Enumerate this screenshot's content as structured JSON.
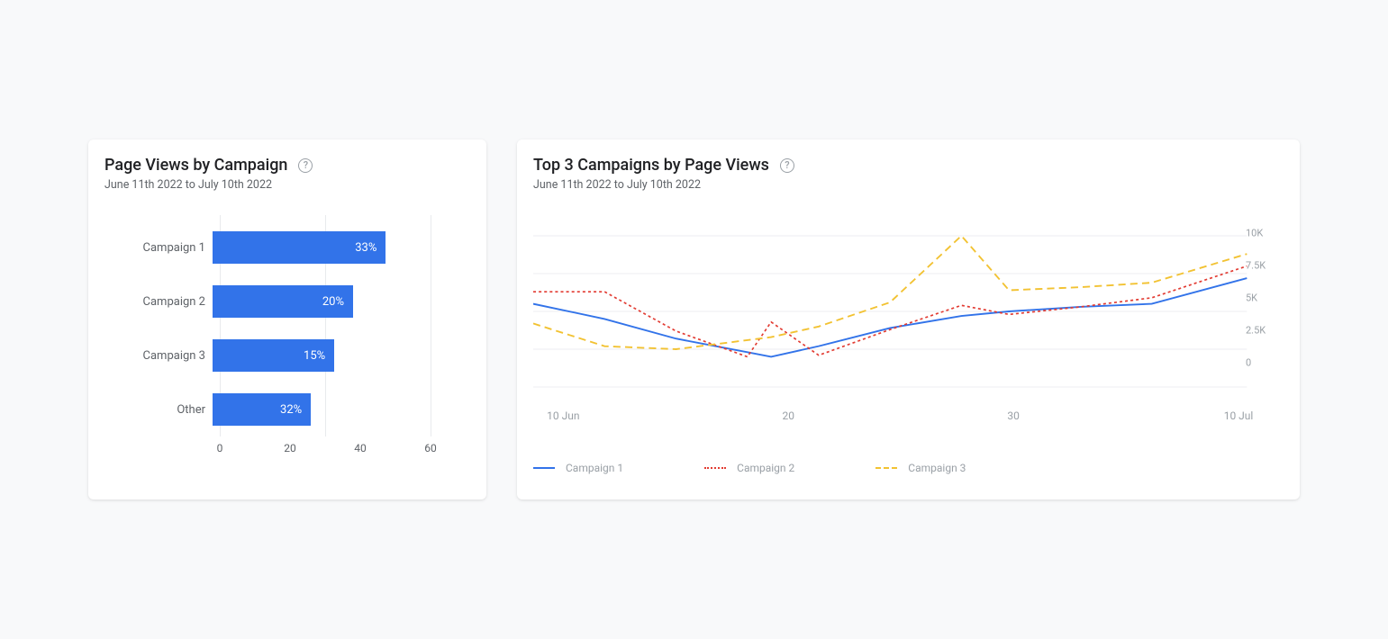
{
  "left_card": {
    "title": "Page Views by Campaign",
    "subtitle": "June 11th 2022 to July 10th 2022"
  },
  "right_card": {
    "title": "Top 3 Campaigns by Page Views",
    "subtitle": "June 11th 2022 to July 10th 2022"
  },
  "bar_labels": {
    "r0": "Campaign 1",
    "r1": "Campaign 2",
    "r2": "Campaign 3",
    "r3": "Other",
    "v0": "33%",
    "v1": "20%",
    "v2": "15%",
    "v3": "32%",
    "x0": "0",
    "x1": "20",
    "x2": "40",
    "x3": "60"
  },
  "line_axis": {
    "y0": "10K",
    "y1": "7.5K",
    "y2": "5K",
    "y3": "2.5K",
    "y4": "0",
    "x0": "10 Jun",
    "x1": "20",
    "x2": "30",
    "x3": "10 Jul"
  },
  "legend": {
    "s1": "Campaign 1",
    "s2": "Campaign 2",
    "s3": "Campaign 3"
  },
  "chart_data": [
    {
      "type": "bar",
      "orientation": "horizontal",
      "title": "Page Views by Campaign",
      "subtitle": "June 11th 2022 to July 10th 2022",
      "xlabel": "",
      "ylabel": "",
      "xlim": [
        0,
        60
      ],
      "categories": [
        "Campaign 1",
        "Campaign 2",
        "Campaign 3",
        "Other"
      ],
      "values": [
        33,
        20,
        15,
        32
      ],
      "value_suffix": "%",
      "color": "#3273e9"
    },
    {
      "type": "line",
      "title": "Top 3 Campaigns by Page Views",
      "subtitle": "June 11th 2022 to July 10th 2022",
      "xlabel": "",
      "ylabel": "",
      "ylim": [
        0,
        10000
      ],
      "y_ticks": [
        0,
        2500,
        5000,
        7500,
        10000
      ],
      "x_tick_labels": [
        "10 Jun",
        "20",
        "30",
        "10 Jul"
      ],
      "x": [
        10,
        13,
        16,
        19,
        20,
        22,
        25,
        28,
        30,
        33,
        36,
        40
      ],
      "series": [
        {
          "name": "Campaign 1",
          "color": "#3273e9",
          "style": "solid",
          "values": [
            5500,
            4500,
            3200,
            2300,
            2000,
            2700,
            3900,
            4700,
            5000,
            5300,
            5500,
            7200
          ]
        },
        {
          "name": "Campaign 2",
          "color": "#e23b32",
          "style": "dotted",
          "values": [
            6300,
            6300,
            3700,
            2000,
            4300,
            2100,
            3800,
            5400,
            4800,
            5300,
            5900,
            8000
          ]
        },
        {
          "name": "Campaign 3",
          "color": "#f2c232",
          "style": "dashed",
          "values": [
            4200,
            2700,
            2500,
            3100,
            3300,
            4000,
            5600,
            10000,
            6400,
            6600,
            6900,
            8800
          ]
        }
      ]
    }
  ]
}
